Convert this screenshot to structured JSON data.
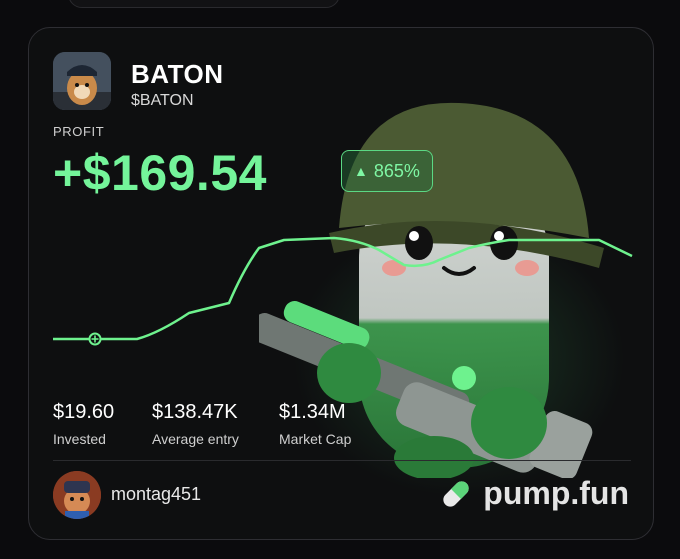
{
  "token": {
    "name": "BATON",
    "ticker": "$BATON"
  },
  "profit": {
    "label": "PROFIT",
    "value": "+$169.54",
    "percent": "865%"
  },
  "stats": {
    "invested": {
      "value": "$19.60",
      "label": "Invested"
    },
    "average_entry": {
      "value": "$138.47K",
      "label": "Average entry"
    },
    "market_cap": {
      "value": "$1.34M",
      "label": "Market Cap"
    }
  },
  "user": {
    "name": "montag451"
  },
  "brand": {
    "name": "pump.fun"
  },
  "icons": [
    "token-avatar-icon",
    "up-triangle-icon",
    "chart-start-marker-icon",
    "user-avatar-icon",
    "pill-logo-icon"
  ],
  "colors": {
    "accent": "#74f49a",
    "card_bg": "#0e0f10",
    "border": "#2e2e33"
  }
}
